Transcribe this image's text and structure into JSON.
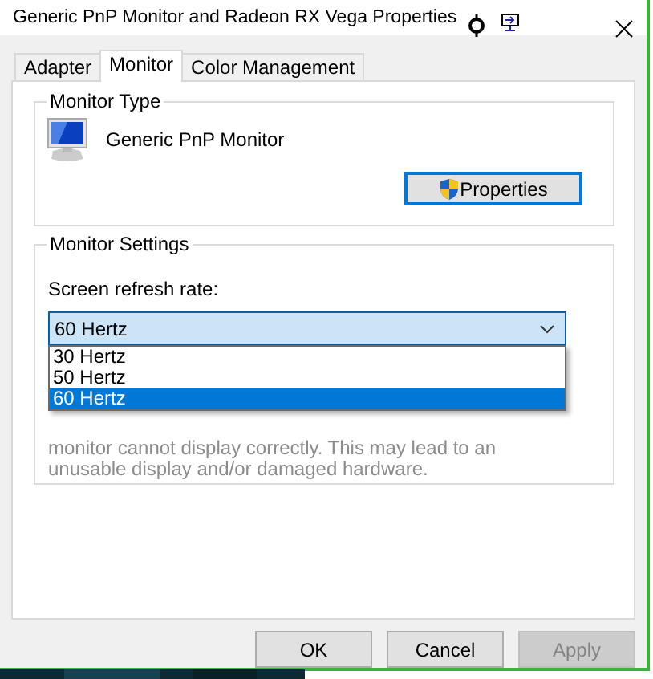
{
  "window": {
    "title": "Generic PnP Monitor and Radeon RX Vega Properties"
  },
  "tabs": [
    {
      "label": "Adapter",
      "selected": false
    },
    {
      "label": "Monitor",
      "selected": true
    },
    {
      "label": "Color Management",
      "selected": false
    }
  ],
  "monitor_type": {
    "heading": "Monitor Type",
    "monitor_name": "Generic PnP Monitor",
    "button": "Properties"
  },
  "monitor_settings": {
    "heading": "Monitor Settings",
    "refresh_label": "Screen refresh rate:",
    "refresh_value": "60 Hertz",
    "options": [
      {
        "label": "30 Hertz",
        "selected": false
      },
      {
        "label": "50 Hertz",
        "selected": false
      },
      {
        "label": "60 Hertz",
        "selected": true
      }
    ],
    "warning": "monitor cannot display correctly. This may lead to an unusable display and/or damaged hardware."
  },
  "buttons": [
    {
      "label": "OK",
      "disabled": false
    },
    {
      "label": "Cancel",
      "disabled": false
    },
    {
      "label": "Apply",
      "disabled": true
    }
  ]
}
